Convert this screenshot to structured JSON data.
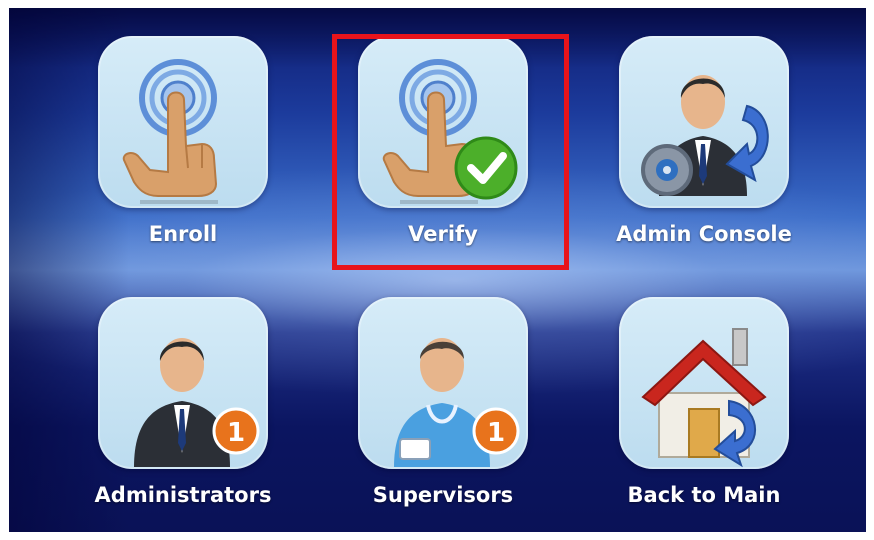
{
  "tiles": [
    {
      "label": "Enroll",
      "icon": "fingerprint-touch-icon"
    },
    {
      "label": "Verify",
      "icon": "fingerprint-verify-icon",
      "selected": true
    },
    {
      "label": "Admin Console",
      "icon": "admin-console-icon"
    },
    {
      "label": "Administrators",
      "icon": "administrator-icon",
      "badge": "1"
    },
    {
      "label": "Supervisors",
      "icon": "supervisor-icon",
      "badge": "1"
    },
    {
      "label": "Back to Main",
      "icon": "home-back-icon"
    }
  ],
  "colors": {
    "selection_border": "#e8141b",
    "tile_background": "#c8e4f4",
    "badge_orange": "#e8731c",
    "check_green": "#4caf2a"
  }
}
